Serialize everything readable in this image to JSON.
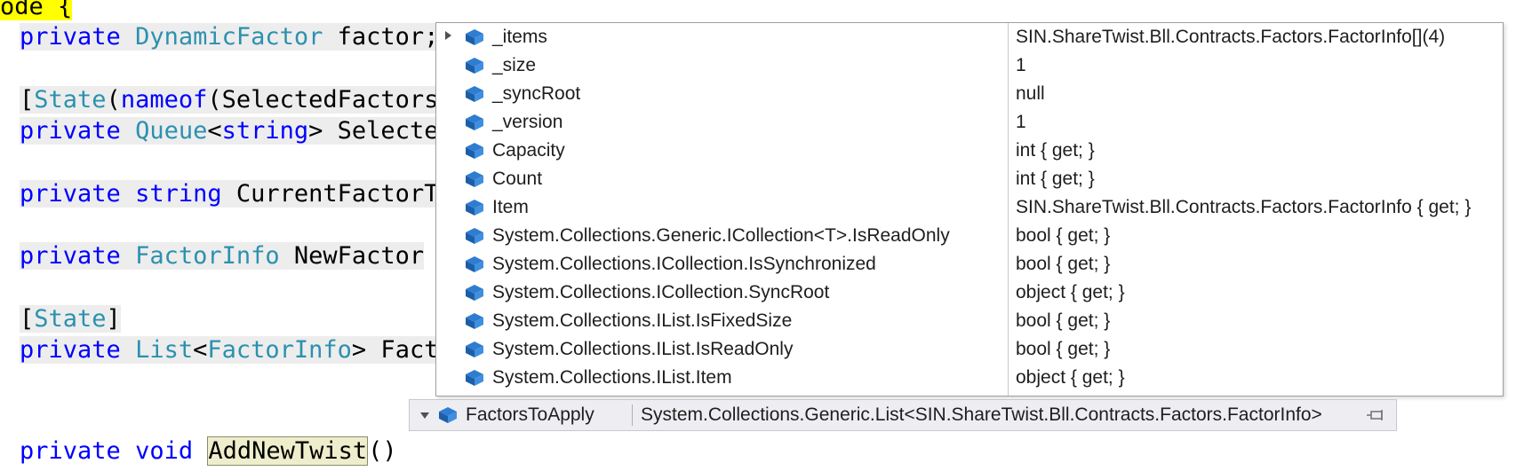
{
  "code": {
    "line0": {
      "a": "ode ",
      "b": "{"
    },
    "line1": {
      "kw": "private",
      "type": "DynamicFactor",
      "rest": "factor;"
    },
    "line2": {
      "open": "[",
      "attr": "State",
      "paren": "(",
      "kw": "nameof",
      "rest": "(SelectedFactors"
    },
    "line3": {
      "kw": "private",
      "type": "Queue",
      "lt": "<",
      "kw2": "string",
      "rest": "> Selecte"
    },
    "line4": {
      "kw": "private",
      "kw2": "string",
      "rest": "CurrentFactorT"
    },
    "line5": {
      "kw": "private",
      "type": "FactorInfo",
      "rest": "NewFactor"
    },
    "line6": {
      "open": "[",
      "attr": "State",
      "close": "]"
    },
    "line7": {
      "kw": "private",
      "type": "List",
      "lt": "<",
      "type2": "FactorInfo",
      "rest": "> Fact"
    },
    "line8": {
      "kw": "private",
      "kw2": "void",
      "method": "AddNewTwist",
      "rest": "()"
    }
  },
  "datatip": {
    "rows": [
      {
        "name": "_items",
        "value": "SIN.ShareTwist.Bll.Contracts.Factors.FactorInfo[](4)",
        "expandable": true
      },
      {
        "name": "_size",
        "value": "1",
        "expandable": false
      },
      {
        "name": "_syncRoot",
        "value": "null",
        "expandable": false
      },
      {
        "name": "_version",
        "value": "1",
        "expandable": false
      },
      {
        "name": "Capacity",
        "value": "int { get; }",
        "expandable": false
      },
      {
        "name": "Count",
        "value": "int { get; }",
        "expandable": false
      },
      {
        "name": "Item",
        "value": "SIN.ShareTwist.Bll.Contracts.Factors.FactorInfo { get; }",
        "expandable": false
      },
      {
        "name": "System.Collections.Generic.ICollection<T>.IsReadOnly",
        "value": "bool { get; }",
        "expandable": false
      },
      {
        "name": "System.Collections.ICollection.IsSynchronized",
        "value": "bool { get; }",
        "expandable": false
      },
      {
        "name": "System.Collections.ICollection.SyncRoot",
        "value": "object { get; }",
        "expandable": false
      },
      {
        "name": "System.Collections.IList.IsFixedSize",
        "value": "bool { get; }",
        "expandable": false
      },
      {
        "name": "System.Collections.IList.IsReadOnly",
        "value": "bool { get; }",
        "expandable": false
      },
      {
        "name": "System.Collections.IList.Item",
        "value": "object { get; }",
        "expandable": false
      }
    ]
  },
  "parent": {
    "name": "FactorsToApply",
    "value": "System.Collections.Generic.List<SIN.ShareTwist.Bll.Contracts.Factors.FactorInfo>",
    "icon": "field-icon",
    "pin_icon": "pin-icon"
  },
  "colors": {
    "keyword": "#0000ff",
    "type": "#2b91af",
    "icon": "#1c5fa8"
  }
}
